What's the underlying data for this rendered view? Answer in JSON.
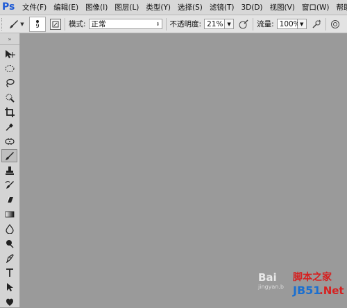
{
  "app": {
    "logo": "Ps"
  },
  "menu": [
    "文件(F)",
    "编辑(E)",
    "图像(I)",
    "图层(L)",
    "类型(Y)",
    "选择(S)",
    "滤镜(T)",
    "3D(D)",
    "视图(V)",
    "窗口(W)",
    "帮助(H)"
  ],
  "options": {
    "brush_size": "9",
    "mode_label": "模式:",
    "mode_value": "正常",
    "opacity_label": "不透明度:",
    "opacity_value": "21%",
    "flow_label": "流量:",
    "flow_value": "100%"
  },
  "tools": [
    "move-tool",
    "marquee-tool",
    "lasso-tool",
    "quick-select-tool",
    "crop-tool",
    "eyedropper-tool",
    "healing-brush-tool",
    "brush-tool",
    "clone-stamp-tool",
    "history-brush-tool",
    "eraser-tool",
    "gradient-tool",
    "blur-tool",
    "dodge-tool",
    "pen-tool",
    "type-tool",
    "path-select-tool",
    "shape-tool"
  ],
  "active_tool": "brush-tool",
  "watermark": {
    "baidu": "Bai",
    "site_cn": "脚本之家",
    "url": "jingyan.b",
    "jb51": "JB51",
    "net": ".Net"
  }
}
